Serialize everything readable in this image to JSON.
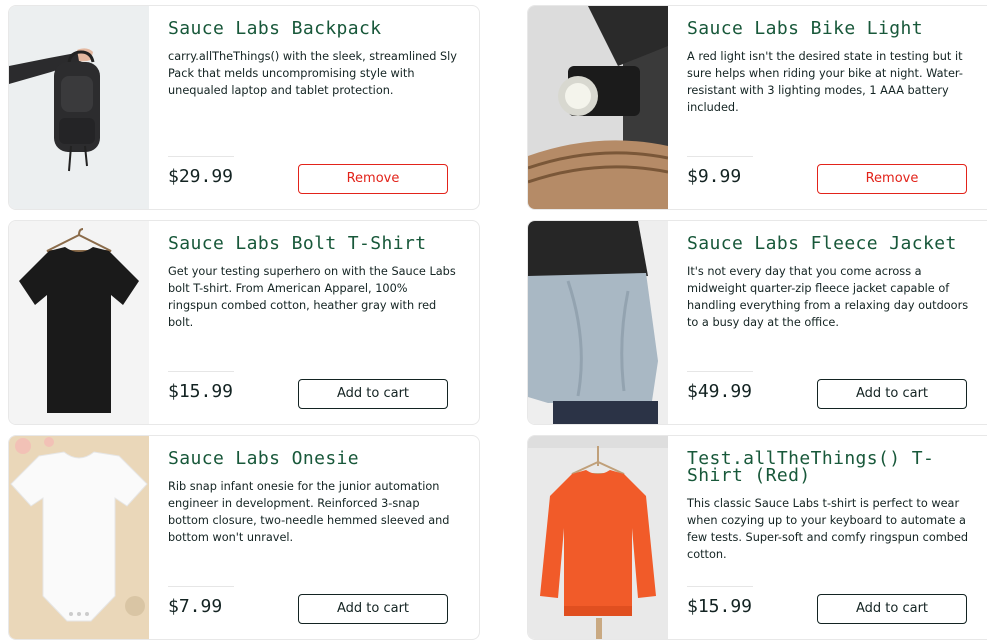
{
  "products": [
    {
      "name": "Sauce Labs Backpack",
      "description": "carry.allTheThings() with the sleek, streamlined Sly Pack that melds uncompromising style with unequaled laptop and tablet protection.",
      "price": "$29.99",
      "button_label": "Remove",
      "button_type": "remove",
      "image_icon": "backpack-image"
    },
    {
      "name": "Sauce Labs Bike Light",
      "description": "A red light isn't the desired state in testing but it sure helps when riding your bike at night. Water-resistant with 3 lighting modes, 1 AAA battery included.",
      "price": "$9.99",
      "button_label": "Remove",
      "button_type": "remove",
      "image_icon": "bike-light-image"
    },
    {
      "name": "Sauce Labs Bolt T-Shirt",
      "description": "Get your testing superhero on with the Sauce Labs bolt T-shirt. From American Apparel, 100% ringspun combed cotton, heather gray with red bolt.",
      "price": "$15.99",
      "button_label": "Add to cart",
      "button_type": "add",
      "image_icon": "black-tshirt-image"
    },
    {
      "name": "Sauce Labs Fleece Jacket",
      "description": "It's not every day that you come across a midweight quarter-zip fleece jacket capable of handling everything from a relaxing day outdoors to a busy day at the office.",
      "price": "$49.99",
      "button_label": "Add to cart",
      "button_type": "add",
      "image_icon": "fleece-jacket-image"
    },
    {
      "name": "Sauce Labs Onesie",
      "description": "Rib snap infant onesie for the junior automation engineer in development. Reinforced 3-snap bottom closure, two-needle hemmed sleeved and bottom won't unravel.",
      "price": "$7.99",
      "button_label": "Add to cart",
      "button_type": "add",
      "image_icon": "onesie-image"
    },
    {
      "name": "Test.allTheThings() T-Shirt (Red)",
      "description": "This classic Sauce Labs t-shirt is perfect to wear when cozying up to your keyboard to automate a few tests. Super-soft and comfy ringspun combed cotton.",
      "price": "$15.99",
      "button_label": "Add to cart",
      "button_type": "add",
      "image_icon": "red-sweatshirt-image"
    }
  ],
  "colors": {
    "title_green": "#18583a",
    "text_dark": "#132322",
    "remove_red": "#e2231a",
    "border": "#e8e8e8"
  }
}
